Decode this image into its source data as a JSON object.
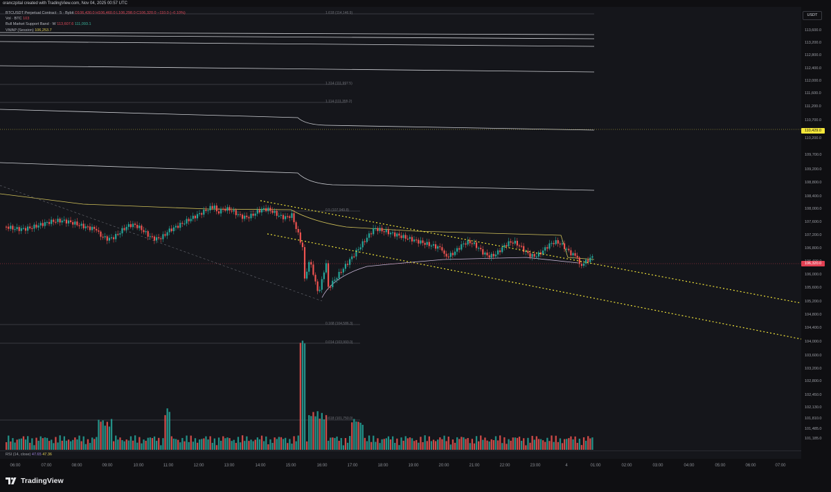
{
  "header": {
    "credit": "oranczpital created with TradingView.com, Nov 04, 2025 00:57 UTC"
  },
  "legend": {
    "symbol": "BTCUSDT Perpetual Contract · 5 · Bybit",
    "ohlc": "O106,430.0 H106,460.0 L106,298.0 C106,320.0 −110.0 (−0.10%)",
    "vol_label": "Vol · BTC",
    "vol_value": "103",
    "bmsb_label": "Bull Market Support Band · W",
    "bmsb_v1": "113,607.6",
    "bmsb_v2": "111,093.1",
    "vwap_label": "VWAP (Session)",
    "vwap_value": "106,253.7"
  },
  "price_axis": {
    "currency": "USDT",
    "labels": [
      "113,600.0",
      "113,200.0",
      "112,800.0",
      "112,400.0",
      "112,000.0",
      "111,600.0",
      "111,200.0",
      "110,700.0",
      "110,200.0",
      "109,700.0",
      "109,200.0",
      "108,800.0",
      "108,400.0",
      "108,000.0",
      "107,600.0",
      "107,200.0",
      "106,800.0",
      "106,400.0",
      "106,000.0",
      "105,600.0",
      "105,200.0",
      "104,800.0",
      "104,400.0",
      "104,000.0",
      "103,600.0",
      "103,200.0",
      "102,800.0",
      "102,450.0",
      "102,130.0",
      "101,810.0",
      "101,485.0",
      "101,185.0"
    ],
    "last_price_yellow": "110,429.0",
    "last_price_red": "106,320.0"
  },
  "fib_labels": [
    "1.618 (114,146.9)",
    "1.314 (111,997.5)",
    "1.114 (111,355.2)",
    "0.5 (107,949.8)",
    "0.168 (104,586.3)",
    "0.014 (103,993.0)",
    "0.618 (101,750.0)"
  ],
  "rsi": {
    "label": "RSI (14, close)",
    "value1": "47.65",
    "value2": "47.36"
  },
  "time_axis": [
    "06:00",
    "07:00",
    "08:00",
    "09:00",
    "10:00",
    "11:00",
    "12:00",
    "13:00",
    "14:00",
    "15:00",
    "16:00",
    "17:00",
    "18:00",
    "19:00",
    "20:00",
    "21:00",
    "22:00",
    "23:00",
    "4",
    "01:00",
    "02:00",
    "03:00",
    "04:00",
    "05:00",
    "06:00",
    "07:00"
  ],
  "footer": {
    "brand": "TradingView"
  },
  "colors": {
    "up": "#26a69a",
    "down": "#ef5350",
    "trend": "#f2e53a",
    "band": "#d4c45a",
    "vwap": "#c9b7d8",
    "fib": "#7c7e86"
  }
}
